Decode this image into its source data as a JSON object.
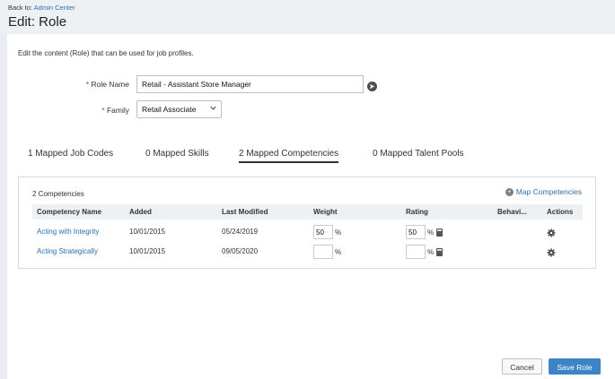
{
  "header": {
    "back_prefix": "Back to:",
    "back_link": "Admin Center",
    "title": "Edit: Role"
  },
  "description": "Edit the content (Role) that can be used for job profiles.",
  "form": {
    "required_mark": "*",
    "role_name_label": "Role Name",
    "role_name_value": "Retail - Assistant Store Manager",
    "family_label": "Family",
    "family_value": "Retail Associate",
    "family_options_shown": [
      "Retail Associate"
    ]
  },
  "tabs": [
    {
      "label": "1 Mapped Job Codes",
      "active": false
    },
    {
      "label": "0 Mapped Skills",
      "active": false
    },
    {
      "label": "2 Mapped Competencies",
      "active": true
    },
    {
      "label": "0 Mapped Talent Pools",
      "active": false
    }
  ],
  "competencies": {
    "count_label": "2 Competencies",
    "map_link": "Map Competencies",
    "columns": [
      "Competency Name",
      "Added",
      "Last Modified",
      "Weight",
      "Rating",
      "Behavi...",
      "Actions"
    ],
    "percent_sign": "%",
    "rows": [
      {
        "name": "Acting with Integrity",
        "added": "10/01/2015",
        "modified": "05/24/2019",
        "weight": "50",
        "rating": "50"
      },
      {
        "name": "Acting Strategically",
        "added": "10/01/2015",
        "modified": "09/05/2020",
        "weight": "",
        "rating": ""
      }
    ]
  },
  "footer": {
    "cancel_label": "Cancel",
    "save_label": "Save Role"
  },
  "colors": {
    "link": "#2a6fb4",
    "primary_button": "#3d84c6",
    "required": "#c0392b"
  },
  "icons": {
    "family_chevron": "chevron-down-icon",
    "role_navigate": "navigate-arrow-icon",
    "map_add": "plus-circle-icon",
    "row_action": "gear-icon",
    "rating_calc": "calculator-icon"
  }
}
